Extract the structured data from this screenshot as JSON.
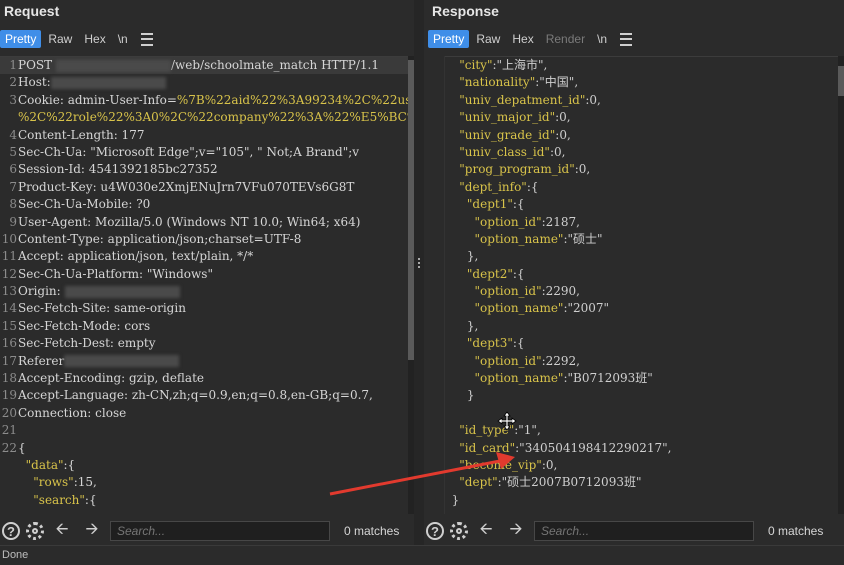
{
  "request": {
    "title": "Request",
    "tabs": [
      {
        "label": "Pretty",
        "active": true
      },
      {
        "label": "Raw"
      },
      {
        "label": "Hex"
      },
      {
        "label": "\\n"
      }
    ],
    "lines": [
      {
        "n": "1",
        "parts": [
          {
            "t": "POST "
          },
          {
            "redact": true
          },
          {
            "t": "/web/schoolmate_match HTTP/1.1"
          }
        ],
        "hl": true
      },
      {
        "n": "2",
        "parts": [
          {
            "t": "Host:"
          },
          {
            "redact": true
          }
        ]
      },
      {
        "n": "3",
        "parts": [
          {
            "t": "Cookie: admin-User-Info="
          },
          {
            "t": "%7B%22aid%22%3A99234%2C%22use",
            "c": "yellow"
          }
        ]
      },
      {
        "n": "",
        "parts": [
          {
            "t": "%2C%22role%22%3A0%2C%22company%22%3A%22%E5%BC%A0%E4%B",
            "c": "yellow"
          }
        ]
      },
      {
        "n": "4",
        "parts": [
          {
            "t": "Content-Length: 177"
          }
        ]
      },
      {
        "n": "5",
        "parts": [
          {
            "t": "Sec-Ch-Ua: \"Microsoft Edge\";v=\"105\", \" Not;A Brand\";v"
          }
        ]
      },
      {
        "n": "6",
        "parts": [
          {
            "t": "Session-Id: 4541392185bc27352"
          }
        ]
      },
      {
        "n": "7",
        "parts": [
          {
            "t": "Product-Key: u4W030e2XmjENuJrn7VFu070TEVs6G8T"
          }
        ]
      },
      {
        "n": "8",
        "parts": [
          {
            "t": "Sec-Ch-Ua-Mobile: ?0"
          }
        ]
      },
      {
        "n": "9",
        "parts": [
          {
            "t": "User-Agent: Mozilla/5.0 (Windows NT 10.0; Win64; x64)"
          }
        ]
      },
      {
        "n": "10",
        "parts": [
          {
            "t": "Content-Type: application/json;charset=UTF-8"
          }
        ]
      },
      {
        "n": "11",
        "parts": [
          {
            "t": "Accept: application/json, text/plain, */*"
          }
        ]
      },
      {
        "n": "12",
        "parts": [
          {
            "t": "Sec-Ch-Ua-Platform: \"Windows\""
          }
        ]
      },
      {
        "n": "13",
        "parts": [
          {
            "t": "Origin: "
          },
          {
            "redact": true
          }
        ]
      },
      {
        "n": "14",
        "parts": [
          {
            "t": "Sec-Fetch-Site: same-origin"
          }
        ]
      },
      {
        "n": "15",
        "parts": [
          {
            "t": "Sec-Fetch-Mode: cors"
          }
        ]
      },
      {
        "n": "16",
        "parts": [
          {
            "t": "Sec-Fetch-Dest: empty"
          }
        ]
      },
      {
        "n": "17",
        "parts": [
          {
            "t": "Referer"
          },
          {
            "redact": true
          }
        ]
      },
      {
        "n": "18",
        "parts": [
          {
            "t": "Accept-Encoding: gzip, deflate"
          }
        ]
      },
      {
        "n": "19",
        "parts": [
          {
            "t": "Accept-Language: zh-CN,zh;q=0.9,en;q=0.8,en-GB;q=0.7,"
          }
        ]
      },
      {
        "n": "20",
        "parts": [
          {
            "t": "Connection: close"
          }
        ]
      },
      {
        "n": "21",
        "parts": [
          {
            "t": ""
          }
        ]
      },
      {
        "n": "22",
        "parts": [
          {
            "t": "{"
          }
        ]
      },
      {
        "n": "",
        "parts": [
          {
            "t": "  "
          },
          {
            "t": "\"data\"",
            "c": "yellow"
          },
          {
            "t": ":{"
          }
        ]
      },
      {
        "n": "",
        "parts": [
          {
            "t": "    "
          },
          {
            "t": "\"rows\"",
            "c": "yellow"
          },
          {
            "t": ":15,"
          }
        ]
      },
      {
        "n": "",
        "parts": [
          {
            "t": "    "
          },
          {
            "t": "\"search\"",
            "c": "yellow"
          },
          {
            "t": ":{"
          }
        ]
      }
    ],
    "search_placeholder": "Search...",
    "matches": "0 matches"
  },
  "response": {
    "title": "Response",
    "tabs": [
      {
        "label": "Pretty",
        "active": true
      },
      {
        "label": "Raw"
      },
      {
        "label": "Hex"
      },
      {
        "label": "Render",
        "disabled": true
      },
      {
        "label": "\\n"
      }
    ],
    "lines": [
      "    \"city\":\"上海市\",",
      "    \"nationality\":\"中国\",",
      "    \"univ_depatment_id\":0,",
      "    \"univ_major_id\":0,",
      "    \"univ_grade_id\":0,",
      "    \"univ_class_id\":0,",
      "    \"prog_program_id\":0,",
      "    \"dept_info\":{",
      "      \"dept1\":{",
      "        \"option_id\":2187,",
      "        \"option_name\":\"硕士\"",
      "      },",
      "      \"dept2\":{",
      "        \"option_id\":2290,",
      "        \"option_name\":\"2007\"",
      "      },",
      "      \"dept3\":{",
      "        \"option_id\":2292,",
      "        \"option_name\":\"B0712093班\"",
      "      }",
      "",
      "    \"id_type\":\"1\",",
      "    \"id_card\":\"340504198412290217\",",
      "    \"become_vip\":0,",
      "    \"dept\":\"硕士2007B0712093班\"",
      "  }"
    ],
    "search_placeholder": "Search...",
    "matches": "0 matches"
  },
  "status": "Done",
  "colors": {
    "accent": "#3f8ee8",
    "annotation_arrow": "#e23a2e"
  }
}
